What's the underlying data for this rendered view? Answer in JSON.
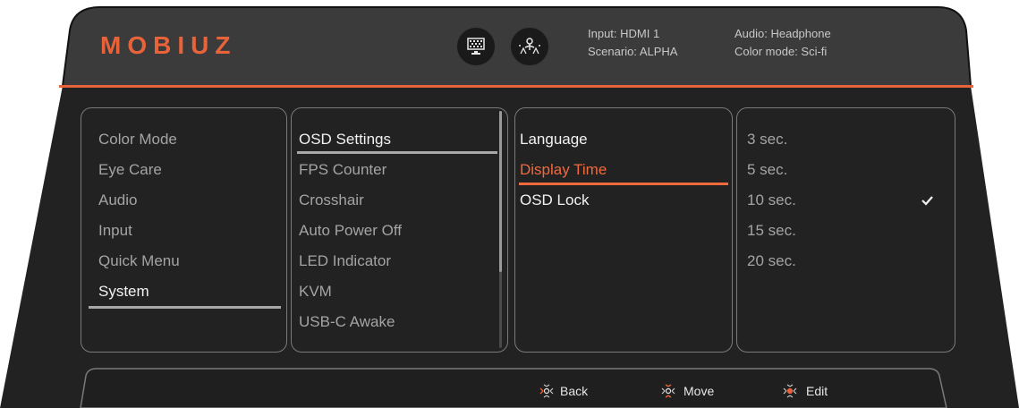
{
  "header": {
    "brand": "MOBIUZ",
    "icons": [
      "color-bars-icon",
      "scenario-figure-icon"
    ],
    "status": {
      "input": "Input: HDMI 1",
      "scenario": "Scenario: ALPHA",
      "audio": "Audio: Headphone",
      "color_mode": "Color mode: Sci-fi"
    }
  },
  "colors": {
    "accent": "#f06a3e",
    "panel_bg": "#222222",
    "header_bg": "#3a3a3a"
  },
  "menu": {
    "level1": {
      "items": [
        "Color Mode",
        "Eye Care",
        "Audio",
        "Input",
        "Quick Menu",
        "System"
      ],
      "selected": "System"
    },
    "level2": {
      "items": [
        "OSD Settings",
        "FPS Counter",
        "Crosshair",
        "Auto Power Off",
        "LED Indicator",
        "KVM",
        "USB-C Awake"
      ],
      "selected": "OSD Settings"
    },
    "level3": {
      "items": [
        "Language",
        "Display Time",
        "OSD Lock"
      ],
      "selected": "Display Time"
    },
    "level4": {
      "items": [
        "3 sec.",
        "5 sec.",
        "10 sec.",
        "15 sec.",
        "20 sec."
      ],
      "checked": "10 sec."
    }
  },
  "footer": {
    "back": "Back",
    "move": "Move",
    "edit": "Edit"
  }
}
